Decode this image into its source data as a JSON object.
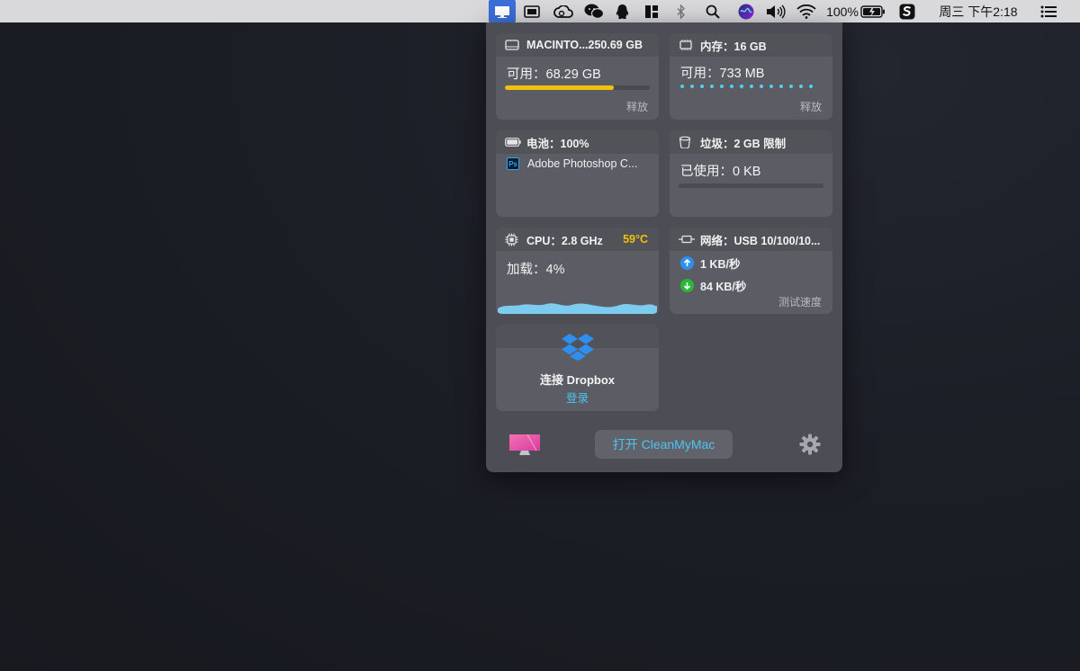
{
  "menubar": {
    "battery_percent": "100%",
    "clock": "周三 下午2:18"
  },
  "disk": {
    "title": "MACINTO...250.69 GB",
    "available": "可用：68.29 GB",
    "action": "释放",
    "used_fraction": 0.75
  },
  "memory": {
    "title": "内存：16 GB",
    "available": "可用：733 MB",
    "action": "释放"
  },
  "battery": {
    "title": "电池：100%",
    "app": "Adobe Photoshop C..."
  },
  "trash": {
    "title": "垃圾：2 GB 限制",
    "used": "已使用：0 KB"
  },
  "cpu": {
    "title": "CPU：2.8 GHz",
    "temp": "59°C",
    "load": "加载：4%"
  },
  "network": {
    "title": "网络：USB 10/100/10...",
    "upload": "1 KB/秒",
    "download": "84 KB/秒",
    "action": "测试速度"
  },
  "dropbox": {
    "title": "连接 Dropbox",
    "login": "登录"
  },
  "footer": {
    "open_label": "打开 CleanMyMac"
  },
  "colors": {
    "accent": "#4cc4f0",
    "disk_bar": "#f2c10c",
    "temp": "#f2c10c",
    "upload": "#2f8ff0",
    "download": "#29b837"
  }
}
